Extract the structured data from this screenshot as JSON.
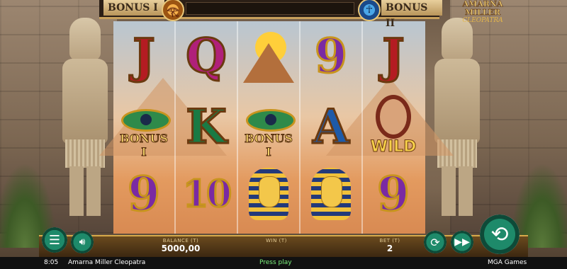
{
  "top": {
    "bonus_left": "BONUS I",
    "bonus_right": "BONUS II",
    "medal_left_icon": "eye-of-horus-icon",
    "medal_right_icon": "ankh-icon"
  },
  "logo": {
    "line1": "AMARNA MILLER",
    "line2": "CLEOPATRA"
  },
  "reels": [
    [
      "J",
      "eye-bonus",
      "9"
    ],
    [
      "Q",
      "K",
      "10"
    ],
    [
      "pyramid",
      "eye-bonus",
      "mask"
    ],
    [
      "9",
      "A",
      "mask"
    ],
    [
      "J",
      "wild",
      "9"
    ]
  ],
  "symbols": {
    "eye_label": "BONUS I",
    "wild_label": "WILD"
  },
  "panel": {
    "balance_label": "BALANCE (T)",
    "balance_value": "5000,00",
    "win_label": "WIN (T)",
    "win_value": "",
    "bet_label": "BET (T)",
    "bet_value": "2"
  },
  "status": {
    "time": "8:05",
    "game_name": "Amarna Miller Cleopatra",
    "message": "Press play",
    "provider": "MGA Games"
  },
  "buttons": {
    "menu": "menu-icon",
    "sound": "speaker-icon",
    "autoplay": "autoplay-icon",
    "fast": "fast-forward-icon",
    "spin": "spin-icon"
  }
}
